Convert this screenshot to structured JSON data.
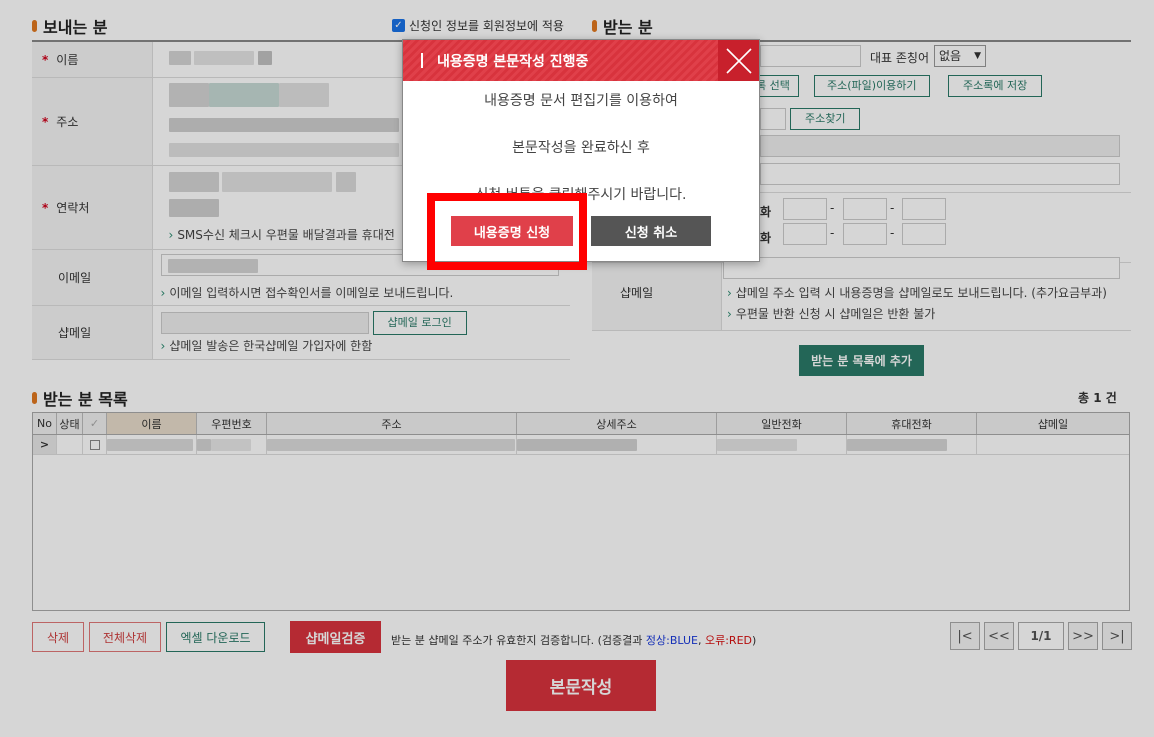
{
  "sender": {
    "title": "보내는 분",
    "apply_checkbox_label": "신청인 정보를 회원정보에 적용",
    "name_label": "이름",
    "address_label": "주소",
    "contact_label": "연락처",
    "contact_note": "SMS수신 체크시 우편물 배달결과를 휴대전",
    "email_label": "이메일",
    "email_note": "이메일 입력하시면 접수확인서를 이메일로 보내드립니다.",
    "shopmail_label": "샵메일",
    "shopmail_login_button": "샵메일 로그인",
    "shopmail_note": "샵메일 발송은 한국샵메일 가입자에 한함"
  },
  "receiver": {
    "title": "받는 분",
    "honorific_label": "대표 존칭어",
    "honorific_value": "없음",
    "list_select_partial": "록 선택",
    "address_file_button": "주소(파일)이용하기",
    "save_address_button": "주소록에 저장",
    "find_address_button": "주소찾기",
    "phone_label_partial_1": "화",
    "phone_label_partial_2": "화",
    "dash": "-",
    "shopmail_label": "샵메일",
    "shopmail_note_1": "샵메일 주소 입력 시 내용증명을 샵메일로도 보내드립니다. (추가요금부과)",
    "shopmail_note_2": "우편물 반환 신청 시 샵메일은 반환 불가",
    "add_to_list_button": "받는 분 목록에 추가"
  },
  "recipient_list": {
    "title": "받는 분 목록",
    "total": "총 1 건",
    "columns": [
      "No",
      "상태",
      "✓",
      "이름",
      "우편번호",
      "주소",
      "상세주소",
      "일반전화",
      "휴대전화",
      "샵메일"
    ],
    "row_expander": ">"
  },
  "bottom": {
    "delete_button": "삭제",
    "delete_all_button": "전체삭제",
    "excel_button": "엑셀 다운로드",
    "shopmail_verify_button": "샵메일검증",
    "verify_note_prefix": "받는 분 샵메일 주소가 유효한지 검증합니다. (검증결과 ",
    "verify_normal": "정상:BLUE",
    "verify_sep": ", ",
    "verify_error": "오류:RED",
    "verify_note_suffix": ")",
    "page_first": "|<",
    "page_prev": "<<",
    "page_indicator": "1/1",
    "page_next": ">>",
    "page_last": ">|",
    "compose_button": "본문작성"
  },
  "modal": {
    "title": "내용증명 본문작성 진행중",
    "line1": "내용증명 문서 편집기를 이용하여",
    "line2": "본문작성을 완료하신 후",
    "line3": "신청 버튼을 클릭해주시기 바랍니다.",
    "apply_button": "내용증명 신청",
    "cancel_button": "신청 취소"
  },
  "colors": {
    "accent_red": "#d8333d",
    "teal": "#2a7a68",
    "highlight": "#ff0000",
    "bullet": "#e07820"
  }
}
